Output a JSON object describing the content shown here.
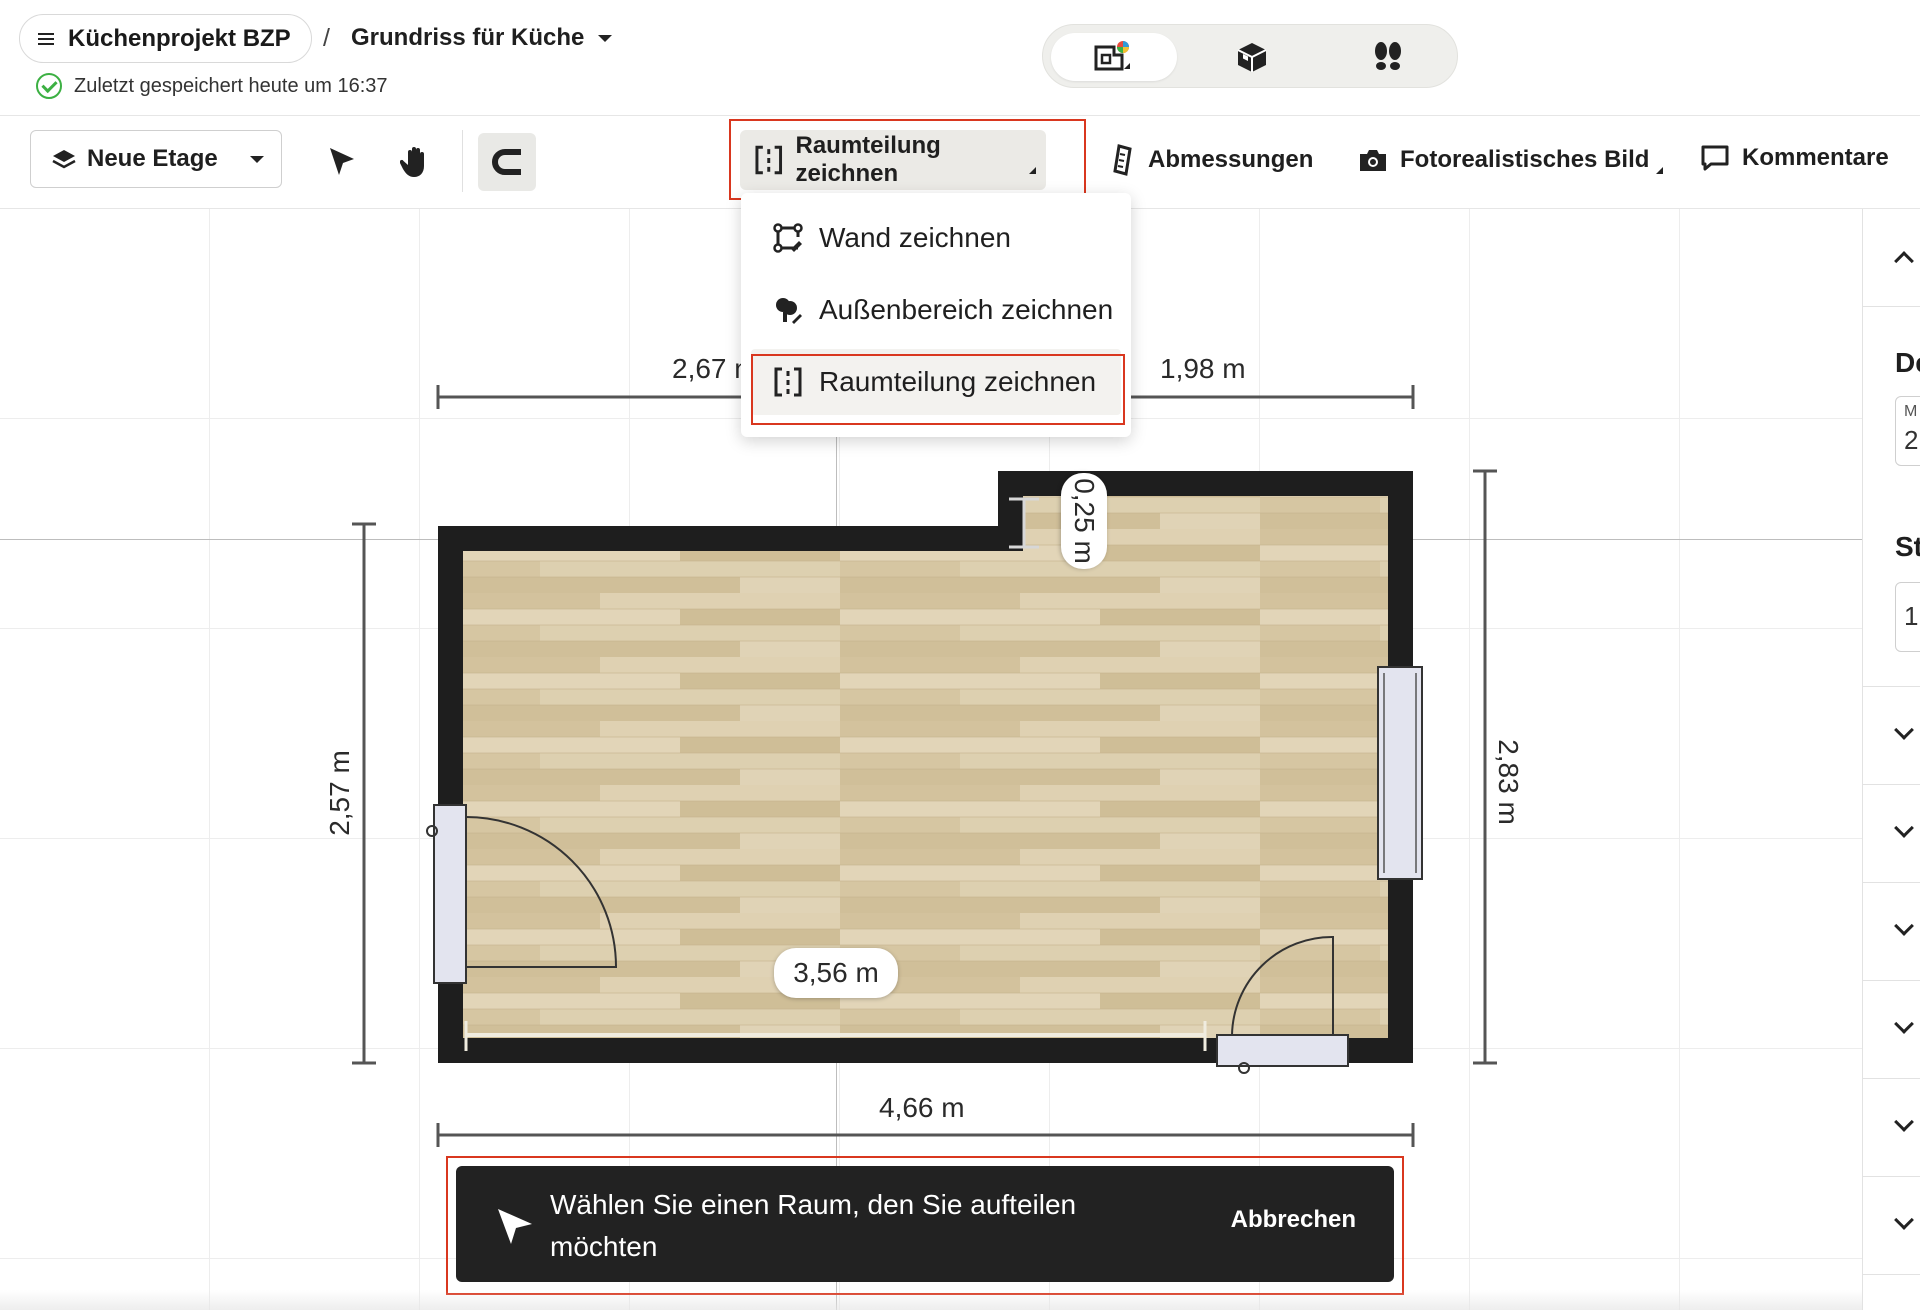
{
  "header": {
    "project_name": "Küchenprojekt BZP",
    "separator": "/",
    "plan_name": "Grundriss für Küche",
    "save_status": "Zuletzt gespeichert heute um 16:37",
    "view_modes": [
      {
        "icon": "floorplan-2d-icon",
        "active": true
      },
      {
        "icon": "3d-box-icon",
        "active": false
      },
      {
        "icon": "walkthrough-footprints-icon",
        "active": false
      }
    ]
  },
  "toolbar": {
    "level_label": "Neue Etage",
    "tools": [
      "select-pointer-icon",
      "pan-hand-icon",
      "magnet-snap-icon"
    ],
    "raumteilung_label": "Raumteilung zeichnen",
    "abmessungen_label": "Abmessungen",
    "foto_label": "Fotorealistisches Bild",
    "kommentare_label": "Kommentare"
  },
  "dropdown": {
    "items": [
      {
        "label": "Wand zeichnen",
        "icon": "wall-draw-icon",
        "selected": false
      },
      {
        "label": "Außenbereich zeichnen",
        "icon": "outdoor-draw-icon",
        "selected": false
      },
      {
        "label": "Raumteilung zeichnen",
        "icon": "room-divider-icon",
        "selected": true
      }
    ]
  },
  "floorplan": {
    "dim_top_left": "2,67 m",
    "dim_top_right": "1,98 m",
    "dim_left": "2,57 m",
    "dim_right": "2,83 m",
    "dim_bottom": "4,66 m",
    "dim_inner_bottom": "3,56 m",
    "dim_notch": "0,25 m",
    "colors": {
      "wall": "#1e1e1e",
      "floor": "#d8c6a3",
      "door_window": "#e3e4ef",
      "highlight": "#d9371f"
    }
  },
  "right_panel": {
    "heading_1": "De",
    "input_1_label": "M",
    "input_1_value": "2",
    "heading_2": "St",
    "input_2_value": "1"
  },
  "toast": {
    "message": "Wählen Sie einen Raum, den Sie aufteilen möchten",
    "action": "Abbrechen"
  }
}
